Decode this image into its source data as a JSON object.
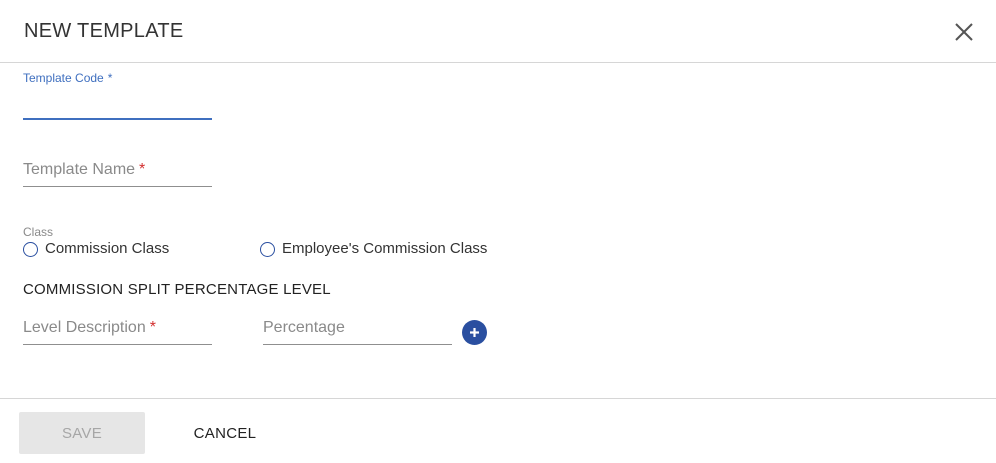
{
  "dialog": {
    "title": "NEW TEMPLATE",
    "close_icon": "close-icon"
  },
  "form": {
    "template_code": {
      "label": "Template Code",
      "required_mark": "*",
      "value": ""
    },
    "template_name": {
      "label": "Template Name",
      "required_mark": "*",
      "value": ""
    },
    "class_group": {
      "label": "Class",
      "options": [
        {
          "label": "Commission Class",
          "selected": false
        },
        {
          "label": "Employee's Commission Class",
          "selected": false
        }
      ]
    },
    "commission_section": {
      "heading": "COMMISSION SPLIT PERCENTAGE LEVEL",
      "level_description": {
        "label": "Level Description",
        "required_mark": "*",
        "value": ""
      },
      "percentage": {
        "label": "Percentage",
        "value": ""
      },
      "add_icon": "plus-icon"
    }
  },
  "footer": {
    "save_label": "SAVE",
    "cancel_label": "CANCEL"
  },
  "colors": {
    "accent": "#2a4fa0",
    "focus": "#3f6fbf",
    "required": "#d32f2f",
    "disabled_bg": "#e6e6e6"
  }
}
